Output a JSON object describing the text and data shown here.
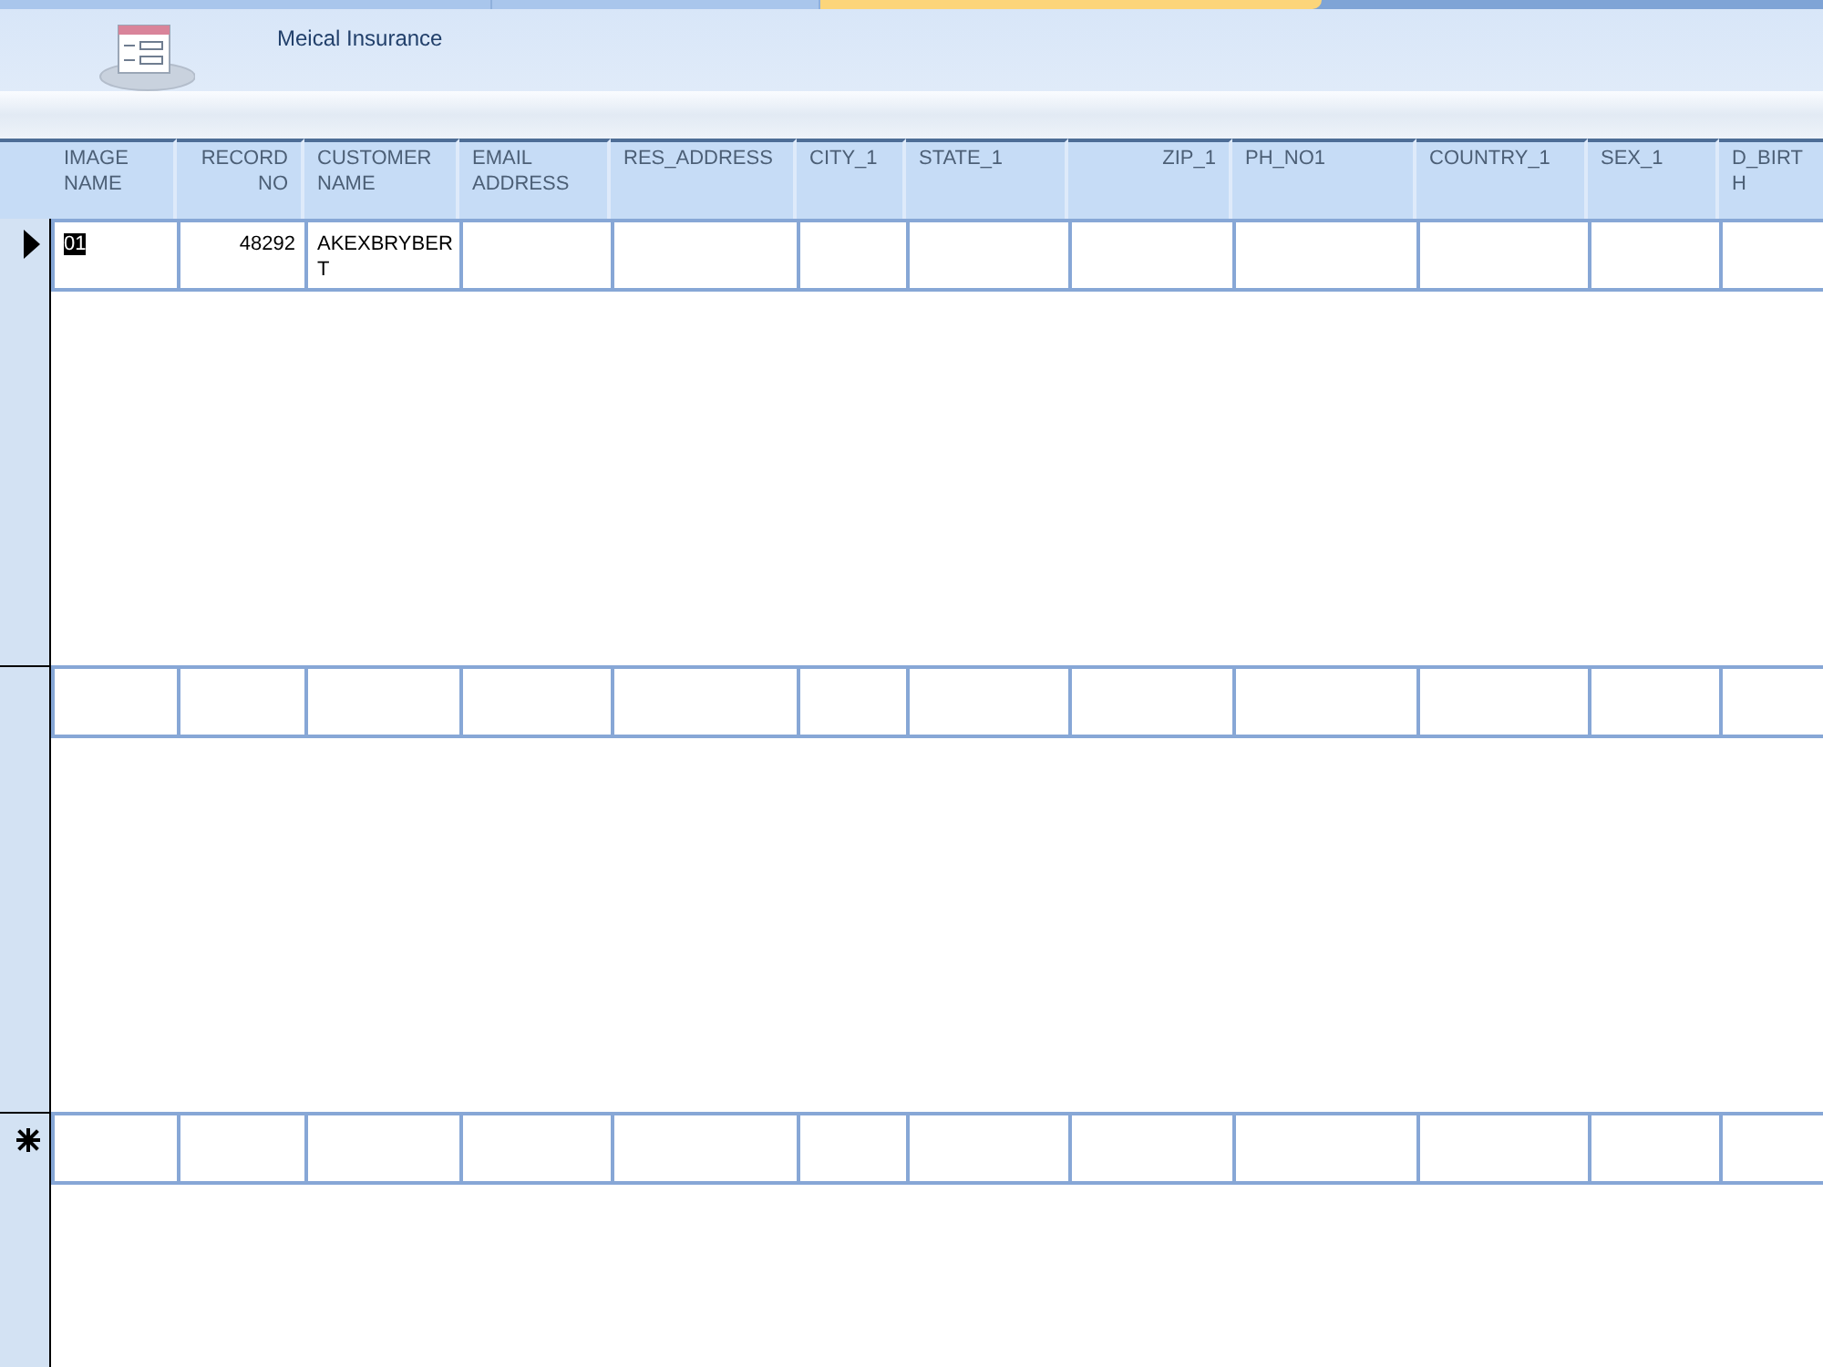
{
  "tabs": [
    {
      "selected": false
    },
    {
      "selected": false
    },
    {
      "selected": true
    }
  ],
  "form": {
    "title": "Meical Insurance"
  },
  "columns": [
    {
      "label": "IMAGE NAME",
      "kind": "text"
    },
    {
      "label": "RECORD NO",
      "kind": "number"
    },
    {
      "label": "CUSTOMER NAME",
      "kind": "text"
    },
    {
      "label": "EMAIL ADDRESS",
      "kind": "text"
    },
    {
      "label": "RES_ADDRESS",
      "kind": "text"
    },
    {
      "label": "CITY_1",
      "kind": "text"
    },
    {
      "label": "STATE_1",
      "kind": "text"
    },
    {
      "label": "ZIP_1",
      "kind": "number"
    },
    {
      "label": "PH_NO1",
      "kind": "text"
    },
    {
      "label": "COUNTRY_1",
      "kind": "text"
    },
    {
      "label": "SEX_1",
      "kind": "text"
    },
    {
      "label": "D_BIRTH",
      "kind": "text"
    }
  ],
  "records": [
    {
      "kind": "current",
      "cells": [
        {
          "text": "01",
          "highlighted": true
        },
        {
          "text": "48292",
          "highlighted": false
        },
        {
          "text": "AKEXBRYBERT",
          "highlighted": false
        }
      ]
    },
    {
      "kind": "record"
    },
    {
      "kind": "new"
    }
  ]
}
